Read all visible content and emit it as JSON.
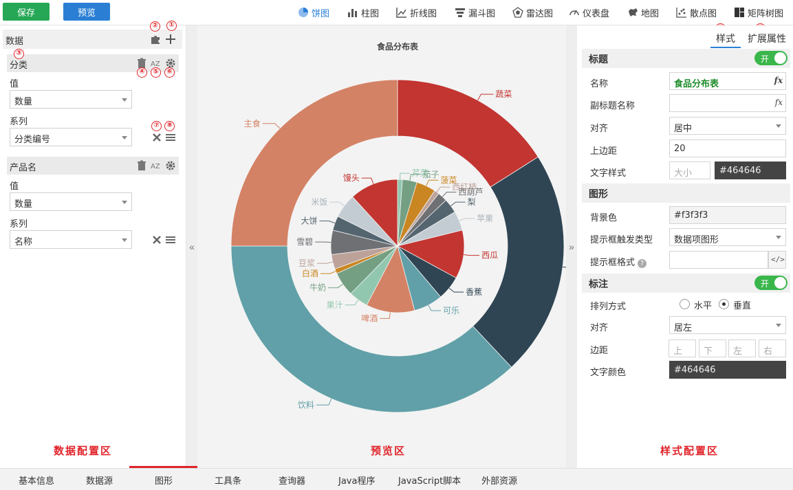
{
  "toolbar": {
    "save_label": "保存",
    "preview_label": "预览",
    "chart_types": [
      {
        "label": "饼图",
        "icon": "pie-chart-icon",
        "active": true
      },
      {
        "label": "柱图",
        "icon": "bar-chart-icon"
      },
      {
        "label": "折线图",
        "icon": "line-chart-icon"
      },
      {
        "label": "漏斗图",
        "icon": "funnel-chart-icon"
      },
      {
        "label": "雷达图",
        "icon": "radar-chart-icon"
      },
      {
        "label": "仪表盘",
        "icon": "gauge-icon"
      },
      {
        "label": "地图",
        "icon": "map-icon"
      },
      {
        "label": "散点图",
        "icon": "scatter-chart-icon"
      },
      {
        "label": "矩阵树图",
        "icon": "treemap-icon"
      }
    ]
  },
  "left": {
    "header": "数据",
    "groups": [
      {
        "title": "分类",
        "value_label": "值",
        "value": "数量",
        "series_label": "系列",
        "series": "分类编号"
      },
      {
        "title": "产品名",
        "value_label": "值",
        "value": "数量",
        "series_label": "系列",
        "series": "名称"
      }
    ],
    "area_label": "数据配置区"
  },
  "badges": [
    "①",
    "②",
    "③",
    "④",
    "⑤",
    "⑥",
    "⑦",
    "⑧",
    "⑨",
    "⑩"
  ],
  "center": {
    "area_label": "预览区"
  },
  "right": {
    "tabs": {
      "style": "样式",
      "ext": "扩展属性"
    },
    "title_section": {
      "heading": "标题",
      "toggle": "开",
      "name_label": "名称",
      "name_value": "食品分布表",
      "subtitle_label": "副标题名称",
      "subtitle_value": "",
      "align_label": "对齐",
      "align_value": "居中",
      "top_margin_label": "上边距",
      "top_margin_value": "20",
      "text_style_label": "文字样式",
      "size_placeholder": "大小",
      "text_color": "#464646"
    },
    "shape_section": {
      "heading": "图形",
      "bg_label": "背景色",
      "bg_value": "#f3f3f3",
      "tooltip_trigger_label": "提示框触发类型",
      "tooltip_trigger_value": "数据项图形",
      "tooltip_format_label": "提示框格式",
      "tooltip_format_value": ""
    },
    "label_section": {
      "heading": "标注",
      "toggle": "开",
      "arrange_label": "排列方式",
      "horizontal": "水平",
      "vertical": "垂直",
      "align_label": "对齐",
      "align_value": "居左",
      "margin_label": "边距",
      "margin_top": "上",
      "margin_bottom": "下",
      "margin_left": "左",
      "margin_right": "右",
      "color_label": "文字颜色",
      "color_value": "#464646"
    },
    "area_label": "样式配置区"
  },
  "bottom_tabs": [
    "基本信息",
    "数据源",
    "图形",
    "工具条",
    "查询器",
    "Java程序",
    "JavaScript脚本",
    "外部资源"
  ],
  "active_bottom_tab": "图形",
  "chart_data": {
    "type": "pie",
    "title": "食品分布表",
    "background": "#f3f3f3",
    "series": [
      {
        "name": "分类",
        "radius": "outer-ring",
        "slices": [
          {
            "label": "蔬菜",
            "value": 16,
            "color": "#c23531"
          },
          {
            "label": "水果",
            "value": 22,
            "color": "#2f4554"
          },
          {
            "label": "饮料",
            "value": 37,
            "color": "#61a0a8"
          },
          {
            "label": "主食",
            "value": 25,
            "color": "#d48265"
          }
        ]
      },
      {
        "name": "产品名",
        "radius": "inner",
        "slices": [
          {
            "label": "芹菜",
            "value": 1,
            "color": "#91c7ae"
          },
          {
            "label": "茄子",
            "value": 3,
            "color": "#749f83"
          },
          {
            "label": "菠菜",
            "value": 4,
            "color": "#ca8622"
          },
          {
            "label": "西红柿",
            "value": 1,
            "color": "#bda29a"
          },
          {
            "label": "西葫芦",
            "value": 2,
            "color": "#6e7074"
          },
          {
            "label": "梨",
            "value": 3,
            "color": "#546570"
          },
          {
            "label": "苹果",
            "value": 4,
            "color": "#c4ccd3"
          },
          {
            "label": "西瓜",
            "value": 10,
            "color": "#c23531"
          },
          {
            "label": "香蕉",
            "value": 5,
            "color": "#2f4554"
          },
          {
            "label": "可乐",
            "value": 6,
            "color": "#61a0a8"
          },
          {
            "label": "啤酒",
            "value": 10,
            "color": "#d48265"
          },
          {
            "label": "果汁",
            "value": 4,
            "color": "#91c7ae"
          },
          {
            "label": "牛奶",
            "value": 5,
            "color": "#749f83"
          },
          {
            "label": "白酒",
            "value": 1,
            "color": "#ca8622"
          },
          {
            "label": "豆浆",
            "value": 3,
            "color": "#bda29a"
          },
          {
            "label": "雪碧",
            "value": 5,
            "color": "#6e7074"
          },
          {
            "label": "大饼",
            "value": 3,
            "color": "#546570"
          },
          {
            "label": "米饭",
            "value": 5,
            "color": "#c4ccd3"
          },
          {
            "label": "馒头",
            "value": 10,
            "color": "#c23531"
          }
        ]
      }
    ]
  }
}
